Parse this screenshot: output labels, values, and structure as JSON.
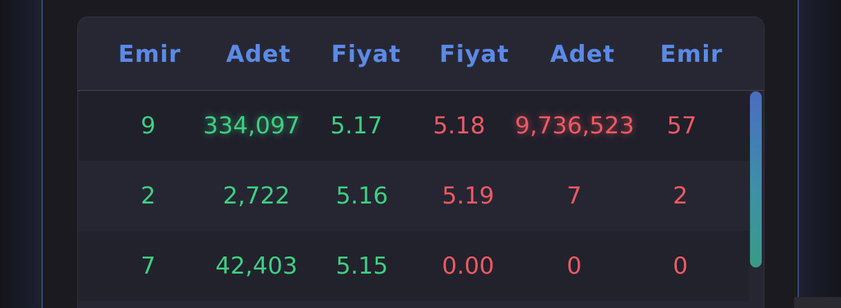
{
  "orderbook": {
    "headers": [
      "Emir",
      "Adet",
      "Fiyat",
      "Fiyat",
      "Adet",
      "Emir"
    ],
    "rows": [
      {
        "buy_orders": "9",
        "buy_qty": "334,097",
        "buy_price": "5.17",
        "sell_price": "5.18",
        "sell_qty": "9,736,523",
        "sell_orders": "57"
      },
      {
        "buy_orders": "2",
        "buy_qty": "2,722",
        "buy_price": "5.16",
        "sell_price": "5.19",
        "sell_qty": "7",
        "sell_orders": "2"
      },
      {
        "buy_orders": "7",
        "buy_qty": "42,403",
        "buy_price": "5.15",
        "sell_price": "0.00",
        "sell_qty": "0",
        "sell_orders": "0"
      }
    ]
  },
  "colors": {
    "header": "#5b8ae6",
    "buy": "#3fcf82",
    "sell": "#ef5a63",
    "panel_bg": "#24242f"
  }
}
